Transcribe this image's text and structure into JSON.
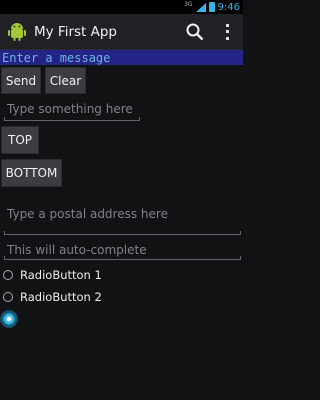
{
  "status_bar": {
    "network": "3G",
    "time": "9:46",
    "icons": [
      "signal-icon",
      "battery-icon"
    ]
  },
  "action_bar": {
    "title": "My First App",
    "icons": [
      "app-icon",
      "search-icon",
      "overflow-menu-icon"
    ]
  },
  "message": {
    "placeholder": "Enter a message",
    "value": ""
  },
  "buttons": {
    "send": "Send",
    "clear": "Clear",
    "top": "TOP",
    "bottom": "BOTTOM"
  },
  "fields": {
    "type_something": "Type something here",
    "postal_address": "Type a postal address here",
    "auto_complete": "This will auto-complete"
  },
  "radios": [
    {
      "label": "RadioButton 1",
      "checked": false
    },
    {
      "label": "RadioButton 2",
      "checked": false
    },
    {
      "label": "",
      "checked": true
    }
  ],
  "colors": {
    "accent": "#33b5e5",
    "input_bg": "#242487",
    "button_bg": "#3b3d40"
  }
}
